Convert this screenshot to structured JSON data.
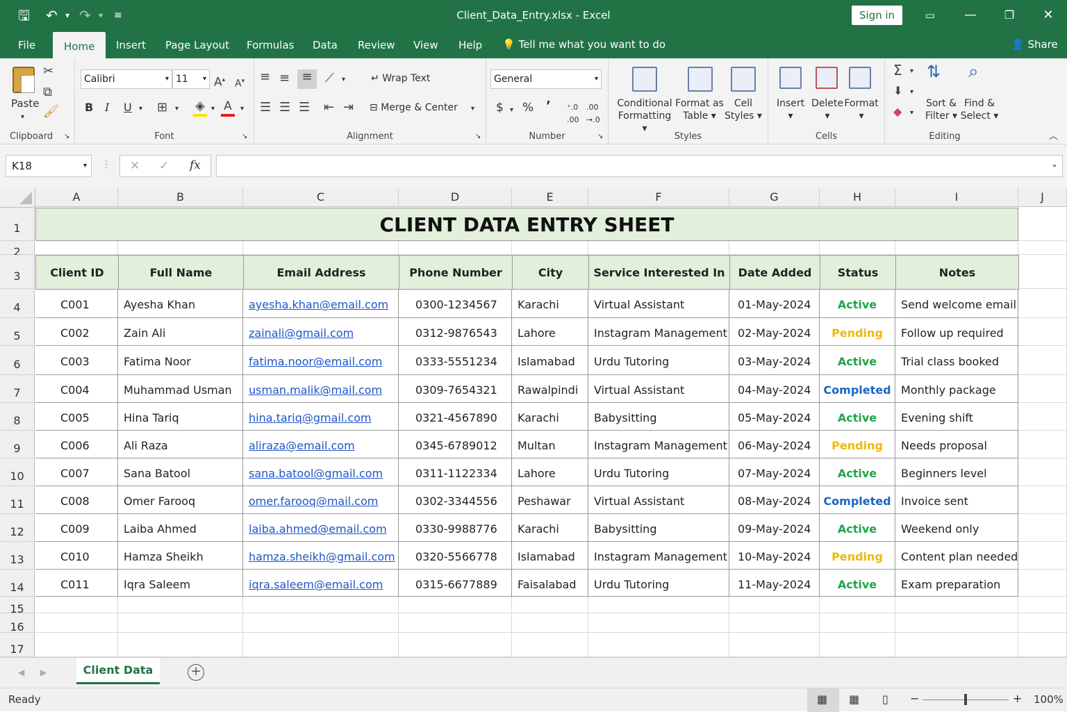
{
  "app": {
    "title": "Client_Data_Entry.xlsx  -  Excel",
    "sign_in": "Sign in"
  },
  "menu": {
    "tabs": [
      "File",
      "Home",
      "Insert",
      "Page Layout",
      "Formulas",
      "Data",
      "Review",
      "View",
      "Help"
    ],
    "tell_me": "Tell me what you want to do",
    "share": "Share"
  },
  "ribbon": {
    "clipboard": {
      "paste": "Paste",
      "label": "Clipboard"
    },
    "font": {
      "name": "Calibri",
      "size": "11",
      "bold": "B",
      "italic": "I",
      "underline": "U",
      "label": "Font"
    },
    "alignment": {
      "wrap": "Wrap Text",
      "merge": "Merge & Center",
      "label": "Alignment"
    },
    "number": {
      "format": "General",
      "currency": "$",
      "percent": "%",
      "comma": "’",
      "label": "Number"
    },
    "styles": {
      "cond1": "Conditional",
      "cond2": "Formatting",
      "fmt1": "Format as",
      "fmt2": "Table",
      "cell1": "Cell",
      "cell2": "Styles",
      "label": "Styles"
    },
    "cells": {
      "insert": "Insert",
      "delete": "Delete",
      "format": "Format",
      "label": "Cells"
    },
    "editing": {
      "sort1": "Sort &",
      "sort2": "Filter",
      "find1": "Find &",
      "find2": "Select",
      "label": "Editing"
    }
  },
  "formula_bar": {
    "name_box": "K18",
    "fx": "fx",
    "value": ""
  },
  "columns": [
    "A",
    "B",
    "C",
    "D",
    "E",
    "F",
    "G",
    "H",
    "I",
    "J"
  ],
  "rows": [
    "1",
    "2",
    "3",
    "4",
    "5",
    "6",
    "7",
    "8",
    "9",
    "10",
    "11",
    "12",
    "13",
    "14",
    "15",
    "16",
    "17"
  ],
  "sheet": {
    "title": "CLIENT DATA ENTRY SHEET",
    "headers": [
      "Client ID",
      "Full Name",
      "Email Address",
      "Phone Number",
      "City",
      "Service Interested In",
      "Date Added",
      "Status",
      "Notes"
    ],
    "records": [
      [
        "C001",
        "Ayesha Khan",
        "ayesha.khan@email.com",
        "0300-1234567",
        "Karachi",
        "Virtual Assistant",
        "01-May-2024",
        "Active",
        "Send welcome email"
      ],
      [
        "C002",
        "Zain Ali",
        "zainali@gmail.com",
        "0312-9876543",
        "Lahore",
        "Instagram Management",
        "02-May-2024",
        "Pending",
        "Follow up required"
      ],
      [
        "C003",
        "Fatima Noor",
        "fatima.noor@email.com",
        "0333-5551234",
        "Islamabad",
        "Urdu Tutoring",
        "03-May-2024",
        "Active",
        "Trial class booked"
      ],
      [
        "C004",
        "Muhammad Usman",
        "usman.malik@mail.com",
        "0309-7654321",
        "Rawalpindi",
        "Virtual Assistant",
        "04-May-2024",
        "Completed",
        "Monthly package"
      ],
      [
        "C005",
        "Hina Tariq",
        "hina.tariq@gmail.com",
        "0321-4567890",
        "Karachi",
        "Babysitting",
        "05-May-2024",
        "Active",
        "Evening shift"
      ],
      [
        "C006",
        "Ali Raza",
        "aliraza@email.com",
        "0345-6789012",
        "Multan",
        "Instagram Management",
        "06-May-2024",
        "Pending",
        "Needs proposal"
      ],
      [
        "C007",
        "Sana Batool",
        "sana.batool@gmail.com",
        "0311-1122334",
        "Lahore",
        "Urdu Tutoring",
        "07-May-2024",
        "Active",
        "Beginners level"
      ],
      [
        "C008",
        "Omer Farooq",
        "omer.farooq@mail.com",
        "0302-3344556",
        "Peshawar",
        "Virtual Assistant",
        "08-May-2024",
        "Completed",
        "Invoice sent"
      ],
      [
        "C009",
        "Laiba Ahmed",
        "laiba.ahmed@email.com",
        "0330-9988776",
        "Karachi",
        "Babysitting",
        "09-May-2024",
        "Active",
        "Weekend only"
      ],
      [
        "C010",
        "Hamza Sheikh",
        "hamza.sheikh@gmail.com",
        "0320-5566778",
        "Islamabad",
        "Instagram Management",
        "10-May-2024",
        "Pending",
        "Content plan needed"
      ],
      [
        "C011",
        "Iqra Saleem",
        "iqra.saleem@email.com",
        "0315-6677889",
        "Faisalabad",
        "Urdu Tutoring",
        "11-May-2024",
        "Active",
        "Exam preparation"
      ]
    ]
  },
  "status_colors": {
    "Active": "#1ea64a",
    "Pending": "#f2b705",
    "Completed": "#1a66c2"
  },
  "sheet_tabs": {
    "active": "Client Data"
  },
  "status": {
    "ready": "Ready",
    "zoom": "100%"
  },
  "colors": {
    "accent": "#217346",
    "header_fill": "#e2efda",
    "link": "#1f55c9"
  }
}
